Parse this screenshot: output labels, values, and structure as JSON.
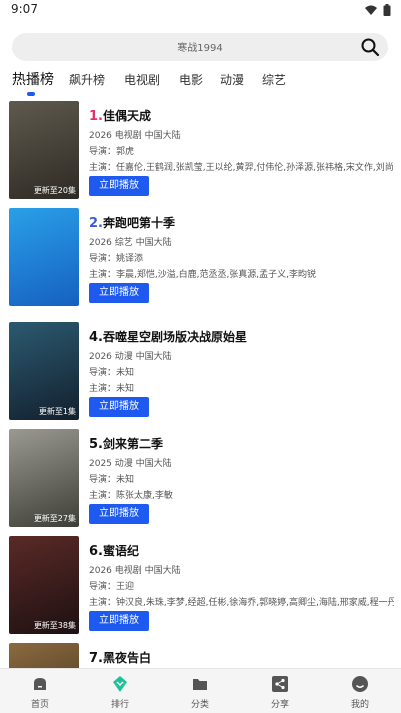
{
  "status": {
    "time": "9:07"
  },
  "search": {
    "placeholder": "寒战1994"
  },
  "tabs": [
    {
      "label": "热播榜",
      "active": true
    },
    {
      "label": "飙升榜",
      "active": false
    },
    {
      "label": "电视剧",
      "active": false
    },
    {
      "label": "电影",
      "active": false
    },
    {
      "label": "动漫",
      "active": false
    },
    {
      "label": "综艺",
      "active": false
    }
  ],
  "items": [
    {
      "rank": "1.",
      "rank_color": "#e0306a",
      "title": "佳偶天成",
      "meta": "2026  电视剧  中国大陆",
      "director": "导演：郭虎",
      "cast": "主演：任嘉伦,王鹤润,张凯莹,王以纶,黄羿,付伟伦,孙泽源,张祎格,宋文作,刘尚",
      "badge": "更新至20集",
      "play": "立即播放",
      "poster_colors": [
        "#5e5a4e",
        "#2e2a24"
      ]
    },
    {
      "rank": "2.",
      "rank_color": "#3a5bd9",
      "title": "奔跑吧第十季",
      "meta": "2026  综艺  中国大陆",
      "director": "导演：姚译添",
      "cast": "主演：李晨,郑恺,沙溢,白鹿,范丞丞,张真源,孟子义,李昀锐",
      "badge": "",
      "play": "立即播放",
      "poster_colors": [
        "#2aa0e8",
        "#1660c0"
      ]
    },
    {
      "rank": "4.",
      "rank_color": "#111111",
      "title": "吞噬星空剧场版决战原始星",
      "meta": "2026  动漫  中国大陆",
      "director": "导演：未知",
      "cast": "主演：未知",
      "badge": "更新至1集",
      "play": "立即播放",
      "poster_colors": [
        "#2c5a70",
        "#12202e"
      ]
    },
    {
      "rank": "5.",
      "rank_color": "#111111",
      "title": "剑来第二季",
      "meta": "2025  动漫  中国大陆",
      "director": "导演：未知",
      "cast": "主演：陈张太康,李敏",
      "badge": "更新至27集",
      "play": "立即播放",
      "poster_colors": [
        "#9a9a92",
        "#3e3e38"
      ]
    },
    {
      "rank": "6.",
      "rank_color": "#111111",
      "title": "蜜语纪",
      "meta": "2026  电视剧  中国大陆",
      "director": "导演：王迎",
      "cast": "主演：钟汉良,朱珠,李梦,经超,任彬,徐海乔,郭晓婷,高卿尘,海陆,邢家威,程一丹",
      "badge": "更新至38集",
      "play": "立即播放",
      "poster_colors": [
        "#5a2a26",
        "#1e1012"
      ]
    },
    {
      "rank": "7.",
      "rank_color": "#111111",
      "title": "黑夜告白",
      "meta": "",
      "director": "",
      "cast": "",
      "badge": "",
      "play": "",
      "poster_colors": [
        "#8a6a40",
        "#3a2a18"
      ]
    }
  ],
  "nav": [
    {
      "label": "首页",
      "icon": "home-icon",
      "active": false
    },
    {
      "label": "排行",
      "icon": "ranking-icon",
      "active": true
    },
    {
      "label": "分类",
      "icon": "folder-icon",
      "active": false
    },
    {
      "label": "分享",
      "icon": "share-icon",
      "active": false
    },
    {
      "label": "我的",
      "icon": "profile-icon",
      "active": false
    }
  ],
  "colors": {
    "accent": "#1e5af0"
  }
}
